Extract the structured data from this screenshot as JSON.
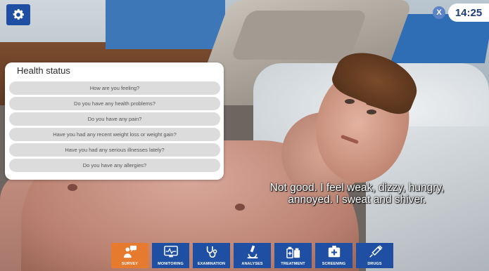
{
  "hud": {
    "timer": "14:25",
    "close_label": "X"
  },
  "health_panel": {
    "title": "Health status",
    "questions": [
      "How are you feeling?",
      "Do you have any health problems?",
      "Do you have any pain?",
      "Have you had any recent weight loss or weight gain?",
      "Have you had any serious illnesses lately?",
      "Do you have any allergies?"
    ]
  },
  "subtitle": {
    "line1": "Not good. I feel weak, dizzy, hungry,",
    "line2": "annoyed. I sweat and shiver."
  },
  "toolbar": {
    "active": "survey",
    "items": [
      {
        "label": "SURVEY",
        "icon": "survey-icon"
      },
      {
        "label": "MONITORING",
        "icon": "monitor-icon"
      },
      {
        "label": "EXAMINATION",
        "icon": "stethoscope-icon"
      },
      {
        "label": "ANALYSES",
        "icon": "microscope-icon"
      },
      {
        "label": "TREATMENT",
        "icon": "medicine-bottles-icon"
      },
      {
        "label": "SCREENING",
        "icon": "screening-icon"
      },
      {
        "label": "DRUGS",
        "icon": "syringe-icon"
      }
    ]
  },
  "colors": {
    "toolbar_blue": "#1f4fa3",
    "toolbar_active": "#e67a2e",
    "timer_text": "#1d3d78"
  }
}
